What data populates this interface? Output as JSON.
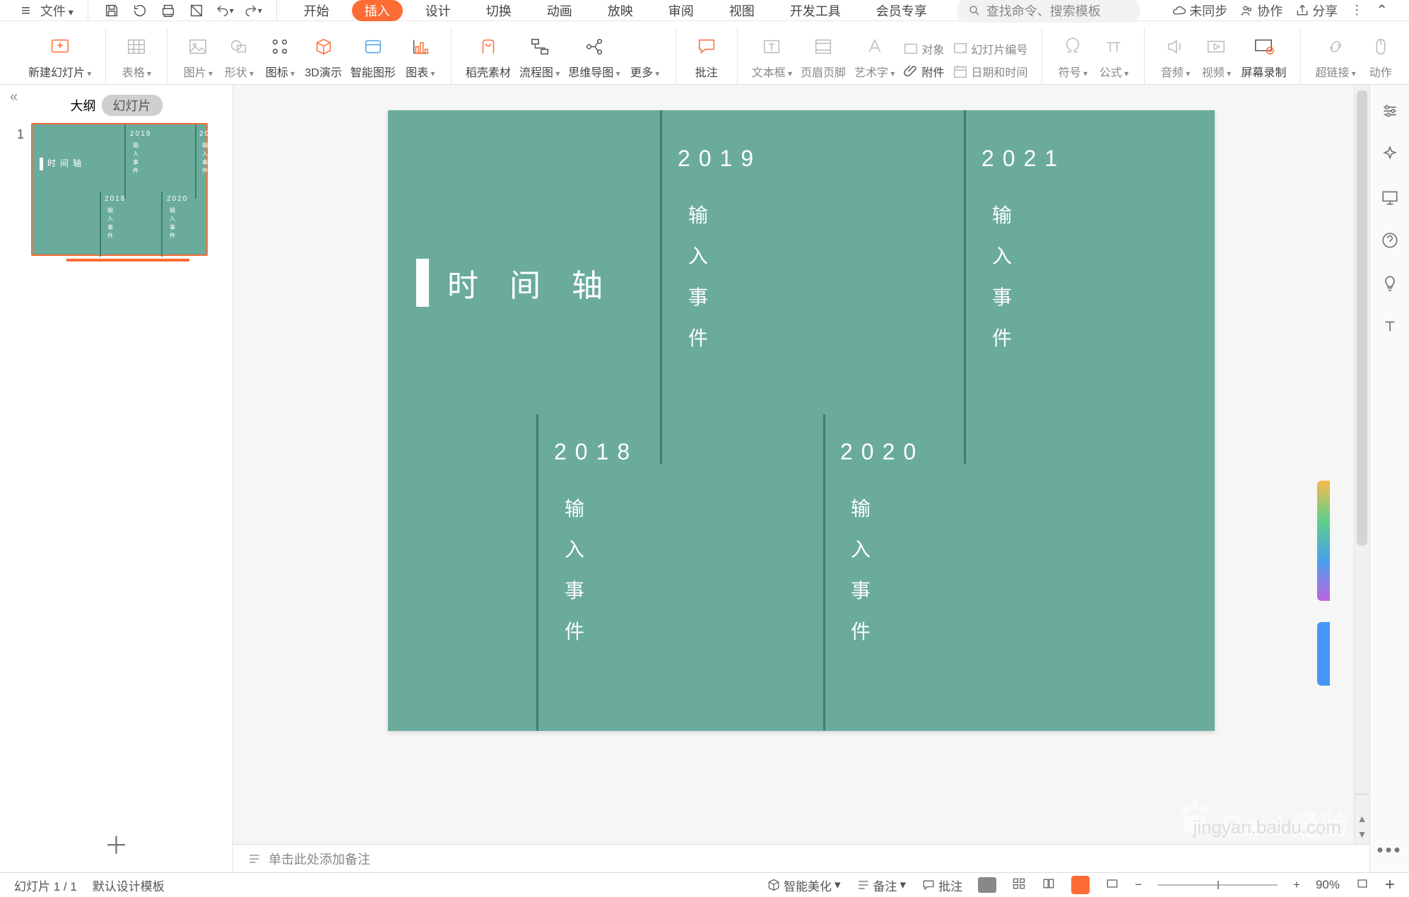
{
  "top": {
    "file": "文件",
    "tabs": [
      "开始",
      "插入",
      "设计",
      "切换",
      "动画",
      "放映",
      "审阅",
      "视图",
      "开发工具",
      "会员专享"
    ],
    "active_tab_index": 1,
    "search_placeholder": "查找命令、搜索模板",
    "sync": "未同步",
    "collab": "协作",
    "share": "分享"
  },
  "ribbon": {
    "new_slide": "新建幻灯片",
    "table": "表格",
    "picture": "图片",
    "shape": "形状",
    "icon": "图标",
    "demo3d": "3D演示",
    "smart": "智能图形",
    "chart": "图表",
    "docer": "稻壳素材",
    "flow": "流程图",
    "mindmap": "思维导图",
    "more": "更多",
    "comment": "批注",
    "textbox": "文本框",
    "headerfooter": "页眉页脚",
    "wordart": "艺术字",
    "object": "对象",
    "slidenum": "幻灯片编号",
    "attach": "附件",
    "datetime": "日期和时间",
    "symbol": "符号",
    "formula": "公式",
    "audio": "音频",
    "video": "视频",
    "record": "屏幕录制",
    "hyperlink": "超链接",
    "action": "动作"
  },
  "sidepanel": {
    "tab_outline": "大纲",
    "tab_slides": "幻灯片",
    "slide_index": "1"
  },
  "slide": {
    "title": "时间轴",
    "events": [
      {
        "year": "2018",
        "text": "输\n入\n事\n件"
      },
      {
        "year": "2019",
        "text": "输\n入\n事\n件"
      },
      {
        "year": "2020",
        "text": "输\n入\n事\n件"
      },
      {
        "year": "2021",
        "text": "输\n入\n事\n件"
      }
    ]
  },
  "notes_placeholder": "单击此处添加备注",
  "status": {
    "slide_counter": "幻灯片 1 / 1",
    "template": "默认设计模板",
    "smart_beautify": "智能美化",
    "notes_btn": "备注",
    "comment_btn": "批注",
    "zoom": "90%"
  },
  "watermark": {
    "brand": "Baid 经验",
    "url": "jingyan.baidu.com"
  }
}
